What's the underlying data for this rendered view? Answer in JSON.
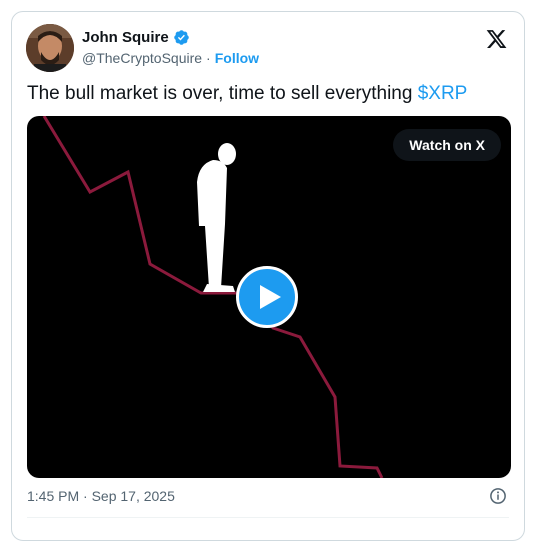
{
  "author": {
    "name": "John Squire",
    "handle": "@TheCryptoSquire",
    "separator": "·",
    "follow_label": "Follow",
    "verified_icon": "verified-badge-icon"
  },
  "platform_icon": "x-logo-icon",
  "tweet": {
    "text": "The bull market is over, time to sell everything ",
    "cashtag": "$XRP"
  },
  "media": {
    "watch_label": "Watch on X",
    "play_icon": "play-icon",
    "line_color": "#8b1a3c"
  },
  "timestamp": "1:45 PM · Sep 17, 2025",
  "info_icon": "info-icon",
  "colors": {
    "accent": "#1d9bf0",
    "text": "#0f1419",
    "muted": "#536471"
  }
}
